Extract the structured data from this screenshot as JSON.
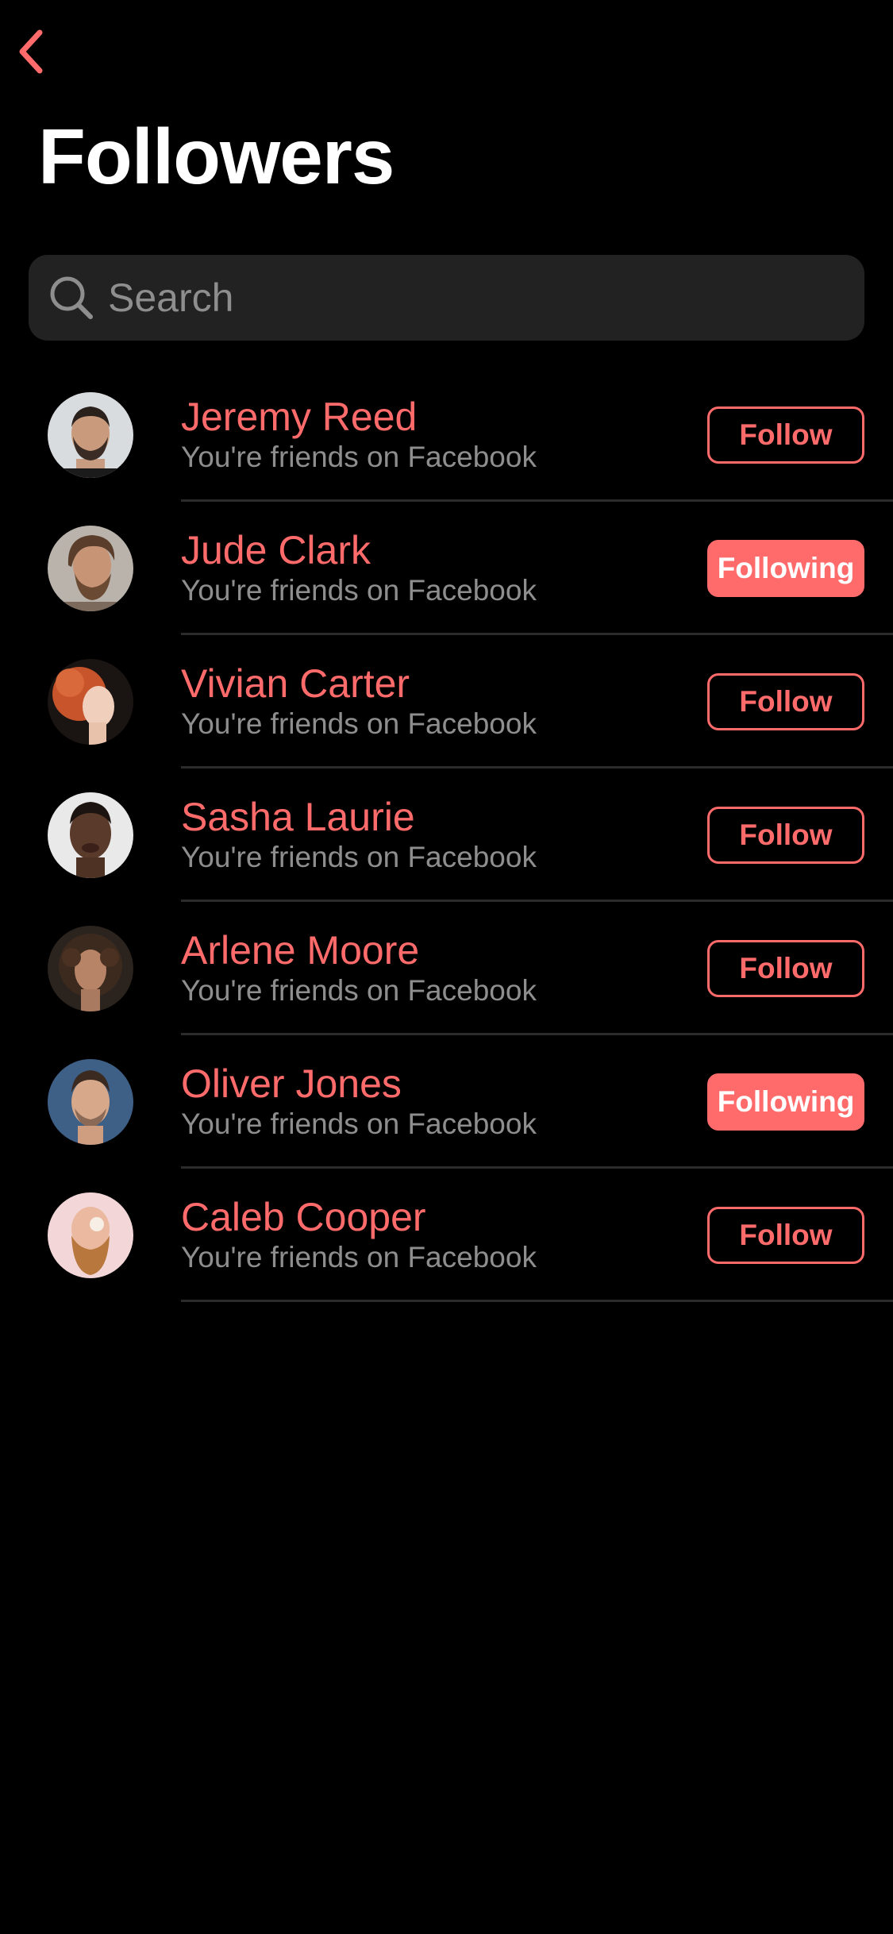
{
  "header": {
    "back_icon": "chevron-left-icon",
    "title": "Followers"
  },
  "search": {
    "icon": "search-icon",
    "placeholder": "Search",
    "value": ""
  },
  "colors": {
    "background": "#000000",
    "accent": "#ff6b6b",
    "search_background": "#222222",
    "secondary_text": "#8e8e8e",
    "divider": "#2b2b2b"
  },
  "followers": [
    {
      "name": "Jeremy Reed",
      "subtitle": "You're friends on Facebook",
      "button": "Follow",
      "following": false
    },
    {
      "name": "Jude Clark",
      "subtitle": "You're friends on Facebook",
      "button": "Following",
      "following": true
    },
    {
      "name": "Vivian Carter",
      "subtitle": "You're friends on Facebook",
      "button": "Follow",
      "following": false
    },
    {
      "name": "Sasha Laurie",
      "subtitle": "You're friends on Facebook",
      "button": "Follow",
      "following": false
    },
    {
      "name": "Arlene Moore",
      "subtitle": "You're friends on Facebook",
      "button": "Follow",
      "following": false
    },
    {
      "name": "Oliver Jones",
      "subtitle": "You're friends on Facebook",
      "button": "Following",
      "following": true
    },
    {
      "name": "Caleb Cooper",
      "subtitle": "You're friends on Facebook",
      "button": "Follow",
      "following": false
    }
  ]
}
